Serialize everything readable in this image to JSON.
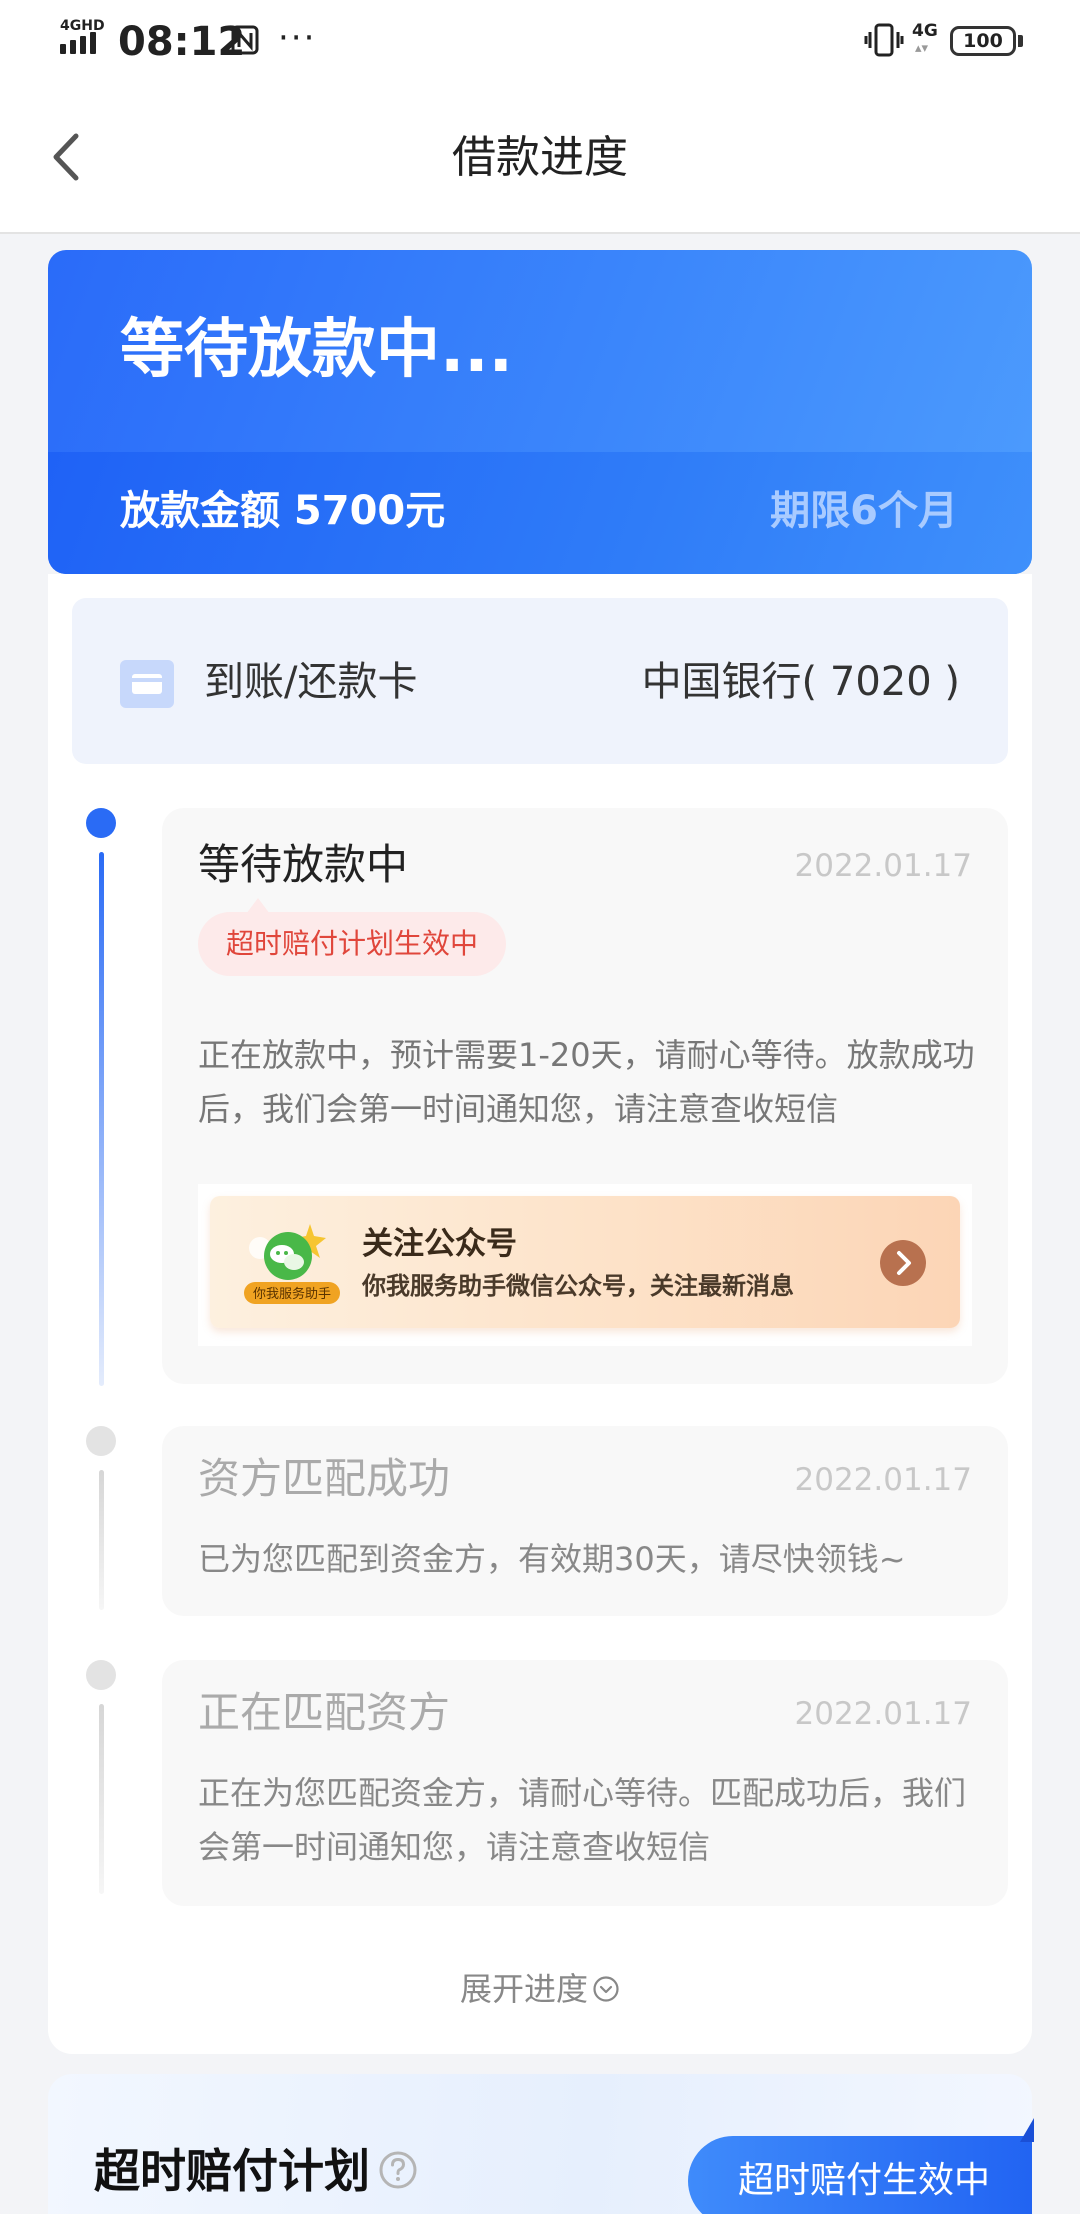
{
  "status_bar": {
    "network_label": "4GHD",
    "time": "08:12",
    "more": "···",
    "mobile_network": "4G",
    "battery": "100"
  },
  "nav": {
    "title": "借款进度"
  },
  "hero": {
    "status": "等待放款中...",
    "amount": "放款金额 5700元",
    "term": "期限6个月"
  },
  "card": {
    "label": "到账/还款卡",
    "bank": "中国银行( 7020 )"
  },
  "steps": [
    {
      "title": "等待放款中",
      "date": "2022.01.17",
      "badge": "超时赔付计划生效中",
      "desc": "正在放款中，预计需要1-20天，请耐心等待。放款成功后，我们会第一时间通知您，请注意查收短信",
      "banner": {
        "title": "关注公众号",
        "subtitle": "你我服务助手微信公众号，关注最新消息",
        "logo_caption": "你我服务助手"
      }
    },
    {
      "title": "资方匹配成功",
      "date": "2022.01.17",
      "desc": "已为您匹配到资金方，有效期30天，请尽快领钱~"
    },
    {
      "title": "正在匹配资方",
      "date": "2022.01.17",
      "desc": "正在为您匹配资金方，请耐心等待。匹配成功后，我们会第一时间通知您，请注意查收短信"
    }
  ],
  "expand_label": "展开进度",
  "compensation": {
    "title": "超时赔付计划",
    "status": "超时赔付生效中"
  },
  "colors": {
    "primary": "#2a6bf5",
    "badge_text": "#e0463b",
    "badge_bg": "#fdeaea",
    "page_bg": "#f3f4f7"
  }
}
